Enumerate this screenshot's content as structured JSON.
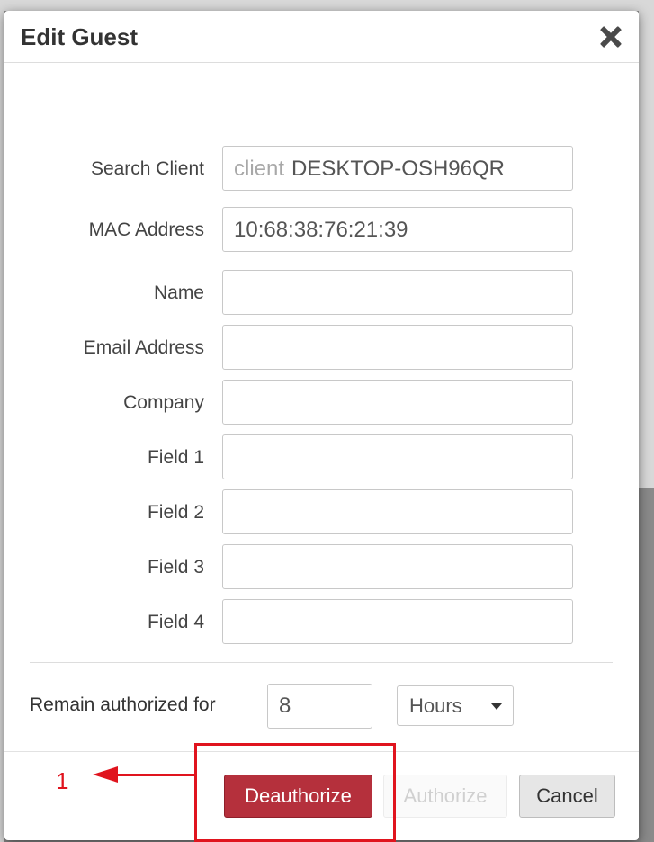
{
  "dialog": {
    "title": "Edit Guest"
  },
  "form": {
    "search_client": {
      "label": "Search Client",
      "prefix": "client",
      "value": "DESKTOP-OSH96QR"
    },
    "mac_address": {
      "label": "MAC Address",
      "value": "10:68:38:76:21:39"
    },
    "name": {
      "label": "Name",
      "value": ""
    },
    "email": {
      "label": "Email Address",
      "value": ""
    },
    "company": {
      "label": "Company",
      "value": ""
    },
    "field1": {
      "label": "Field 1",
      "value": ""
    },
    "field2": {
      "label": "Field 2",
      "value": ""
    },
    "field3": {
      "label": "Field 3",
      "value": ""
    },
    "field4": {
      "label": "Field 4",
      "value": ""
    }
  },
  "duration": {
    "label": "Remain authorized for",
    "value": "8",
    "unit": "Hours"
  },
  "buttons": {
    "deauthorize": "Deauthorize",
    "authorize": "Authorize",
    "cancel": "Cancel"
  },
  "annotation": {
    "number": "1",
    "color": "#e0141e"
  },
  "colors": {
    "deauthorize_bg": "#b5303c",
    "cancel_bg": "#e6e6e6"
  }
}
